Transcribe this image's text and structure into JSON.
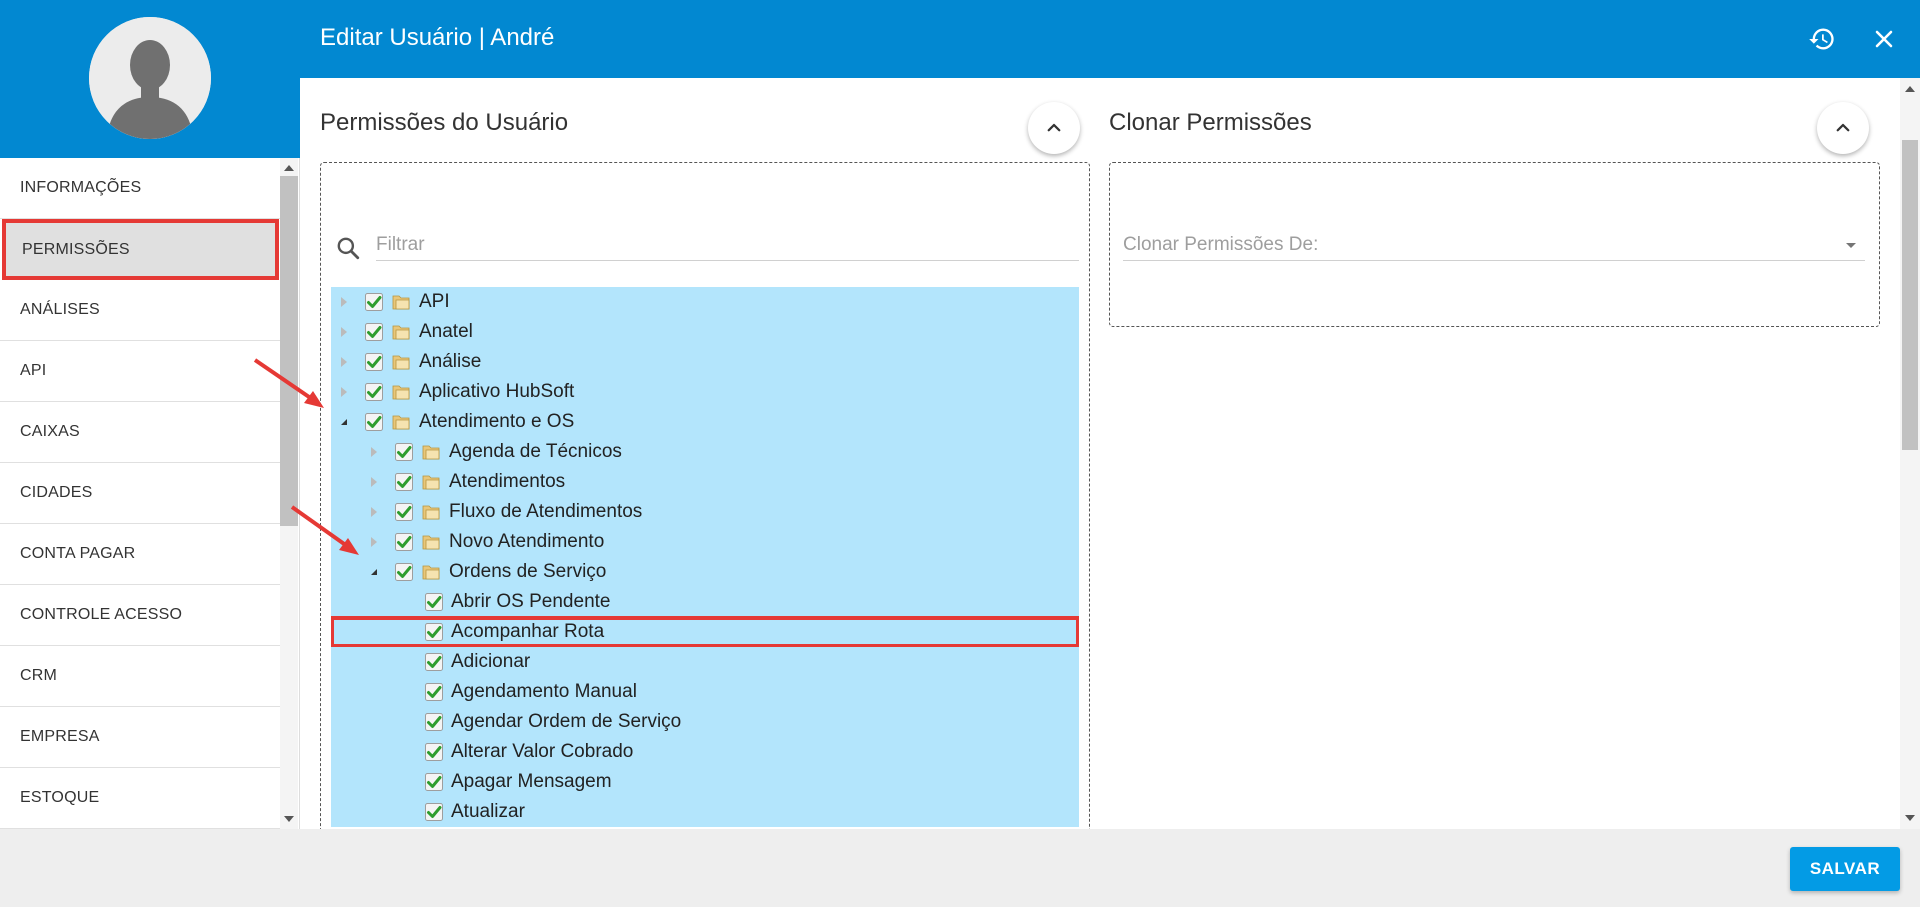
{
  "topbar": {
    "title": "Editar Usuário | André",
    "history_icon": "history-icon",
    "close_icon": "close-icon"
  },
  "sidebar": {
    "avatar_icon": "user-silhouette-icon",
    "items": [
      {
        "label": "INFORMAÇÕES",
        "active": false
      },
      {
        "label": "PERMISSÕES",
        "active": true
      },
      {
        "label": "ANÁLISES",
        "active": false
      },
      {
        "label": "API",
        "active": false
      },
      {
        "label": "CAIXAS",
        "active": false
      },
      {
        "label": "CIDADES",
        "active": false
      },
      {
        "label": "CONTA PAGAR",
        "active": false
      },
      {
        "label": "CONTROLE ACESSO",
        "active": false
      },
      {
        "label": "CRM",
        "active": false
      },
      {
        "label": "EMPRESA",
        "active": false
      },
      {
        "label": "ESTOQUE",
        "active": false
      }
    ]
  },
  "permissions": {
    "title": "Permissões do Usuário",
    "filter_placeholder": "Filtrar",
    "tree": [
      {
        "label": "API",
        "level": 0,
        "state": "collapsed",
        "folder": true,
        "checked": true
      },
      {
        "label": "Anatel",
        "level": 0,
        "state": "collapsed",
        "folder": true,
        "checked": true
      },
      {
        "label": "Análise",
        "level": 0,
        "state": "collapsed",
        "folder": true,
        "checked": true
      },
      {
        "label": "Aplicativo HubSoft",
        "level": 0,
        "state": "collapsed",
        "folder": true,
        "checked": true
      },
      {
        "label": "Atendimento e OS",
        "level": 0,
        "state": "expanded",
        "folder": true,
        "checked": true
      },
      {
        "label": "Agenda de Técnicos",
        "level": 1,
        "state": "collapsed",
        "folder": true,
        "checked": true
      },
      {
        "label": "Atendimentos",
        "level": 1,
        "state": "collapsed",
        "folder": true,
        "checked": true
      },
      {
        "label": "Fluxo de Atendimentos",
        "level": 1,
        "state": "collapsed",
        "folder": true,
        "checked": true
      },
      {
        "label": "Novo Atendimento",
        "level": 1,
        "state": "collapsed",
        "folder": true,
        "checked": true
      },
      {
        "label": "Ordens de Serviço",
        "level": 1,
        "state": "expanded",
        "folder": true,
        "checked": true
      },
      {
        "label": "Abrir OS Pendente",
        "level": 2,
        "state": "leaf",
        "folder": false,
        "checked": true
      },
      {
        "label": "Acompanhar Rota",
        "level": 2,
        "state": "leaf",
        "folder": false,
        "checked": true,
        "highlight": true
      },
      {
        "label": "Adicionar",
        "level": 2,
        "state": "leaf",
        "folder": false,
        "checked": true
      },
      {
        "label": "Agendamento Manual",
        "level": 2,
        "state": "leaf",
        "folder": false,
        "checked": true
      },
      {
        "label": "Agendar Ordem de Serviço",
        "level": 2,
        "state": "leaf",
        "folder": false,
        "checked": true
      },
      {
        "label": "Alterar Valor Cobrado",
        "level": 2,
        "state": "leaf",
        "folder": false,
        "checked": true
      },
      {
        "label": "Apagar Mensagem",
        "level": 2,
        "state": "leaf",
        "folder": false,
        "checked": true
      },
      {
        "label": "Atualizar",
        "level": 2,
        "state": "leaf",
        "folder": false,
        "checked": true
      }
    ]
  },
  "clone": {
    "title": "Clonar Permissões",
    "select_placeholder": "Clonar Permissões De:"
  },
  "footer": {
    "save_label": "SALVAR"
  },
  "colors": {
    "primary": "#0288d1",
    "tree_row_bg": "#b3e5fc",
    "highlight": "#e53935",
    "save_button": "#039be5"
  }
}
